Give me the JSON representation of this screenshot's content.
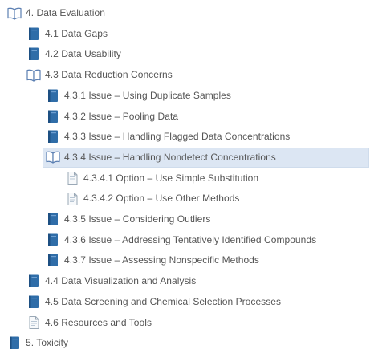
{
  "colors": {
    "book_closed": "#2f6da8",
    "book_open": "#5b7fb2",
    "page": "#9aa8b6",
    "selected_bg": "#dce6f3",
    "text": "#555555"
  },
  "tree": {
    "items": [
      {
        "label": "4. Data Evaluation",
        "icon": "book-open-icon",
        "level": 0,
        "selected": false
      },
      {
        "label": "4.1 Data Gaps",
        "icon": "book-closed-icon",
        "level": 1,
        "selected": false
      },
      {
        "label": "4.2 Data Usability",
        "icon": "book-closed-icon",
        "level": 1,
        "selected": false
      },
      {
        "label": "4.3 Data Reduction Concerns",
        "icon": "book-open-icon",
        "level": 1,
        "selected": false
      },
      {
        "label": "4.3.1 Issue – Using Duplicate Samples",
        "icon": "book-closed-icon",
        "level": 2,
        "selected": false
      },
      {
        "label": "4.3.2 Issue – Pooling Data",
        "icon": "book-closed-icon",
        "level": 2,
        "selected": false
      },
      {
        "label": "4.3.3 Issue – Handling Flagged Data Concentrations",
        "icon": "book-closed-icon",
        "level": 2,
        "selected": false
      },
      {
        "label": "4.3.4 Issue – Handling Nondetect Concentrations",
        "icon": "book-open-icon",
        "level": 2,
        "selected": true
      },
      {
        "label": "4.3.4.1 Option – Use Simple Substitution",
        "icon": "page-icon",
        "level": 3,
        "selected": false
      },
      {
        "label": "4.3.4.2 Option – Use Other Methods",
        "icon": "page-icon",
        "level": 3,
        "selected": false
      },
      {
        "label": "4.3.5 Issue – Considering Outliers",
        "icon": "book-closed-icon",
        "level": 2,
        "selected": false
      },
      {
        "label": "4.3.6 Issue – Addressing Tentatively Identified Compounds",
        "icon": "book-closed-icon",
        "level": 2,
        "selected": false
      },
      {
        "label": "4.3.7 Issue – Assessing Nonspecific Methods",
        "icon": "book-closed-icon",
        "level": 2,
        "selected": false
      },
      {
        "label": "4.4 Data Visualization and Analysis",
        "icon": "book-closed-icon",
        "level": 1,
        "selected": false
      },
      {
        "label": "4.5 Data Screening and Chemical Selection Processes",
        "icon": "book-closed-icon",
        "level": 1,
        "selected": false
      },
      {
        "label": "4.6 Resources and Tools",
        "icon": "page-icon",
        "level": 1,
        "selected": false
      },
      {
        "label": "5. Toxicity",
        "icon": "book-closed-icon",
        "level": 0,
        "selected": false
      }
    ]
  }
}
